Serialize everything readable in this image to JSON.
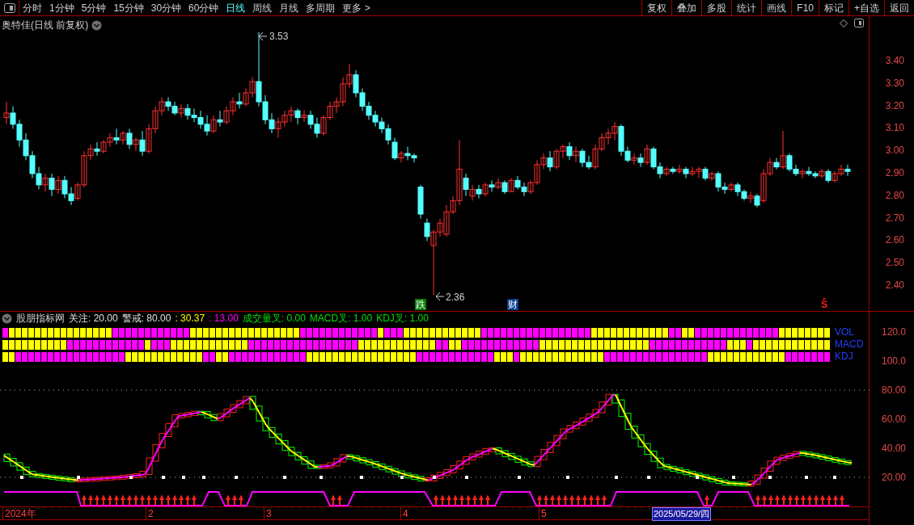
{
  "toolbar": {
    "periods": [
      {
        "label": "分时",
        "selected": false
      },
      {
        "label": "1分钟",
        "selected": false
      },
      {
        "label": "5分钟",
        "selected": false
      },
      {
        "label": "15分钟",
        "selected": false
      },
      {
        "label": "30分钟",
        "selected": false
      },
      {
        "label": "60分钟",
        "selected": false
      },
      {
        "label": "日线",
        "selected": true
      },
      {
        "label": "周线",
        "selected": false
      },
      {
        "label": "月线",
        "selected": false
      },
      {
        "label": "多周期",
        "selected": false
      },
      {
        "label": "更多 >",
        "selected": false
      }
    ],
    "buttons": [
      "复权",
      "叠加",
      "多股",
      "统计",
      "画线",
      "F10",
      "标记",
      "+自选",
      "返回"
    ]
  },
  "chart": {
    "title": "奥特佳(日线 前复权)",
    "high_marker": "3.53",
    "low_marker": "2.36",
    "events": [
      {
        "label": "跌",
        "color": "#008000"
      },
      {
        "label": "财",
        "color": "#0a3a8a"
      },
      {
        "label": "Ŝ",
        "color": "#000000"
      }
    ],
    "chart_data": {
      "type": "candlestick",
      "ohlc": [
        [
          3.15,
          3.22,
          3.12,
          3.17
        ],
        [
          3.17,
          3.2,
          3.1,
          3.12
        ],
        [
          3.12,
          3.14,
          3.02,
          3.05
        ],
        [
          3.05,
          3.08,
          2.96,
          2.98
        ],
        [
          2.98,
          3.0,
          2.88,
          2.9
        ],
        [
          2.9,
          2.93,
          2.83,
          2.85
        ],
        [
          2.85,
          2.9,
          2.82,
          2.88
        ],
        [
          2.88,
          2.9,
          2.8,
          2.83
        ],
        [
          2.83,
          2.89,
          2.81,
          2.87
        ],
        [
          2.87,
          2.89,
          2.79,
          2.81
        ],
        [
          2.81,
          2.84,
          2.76,
          2.78
        ],
        [
          2.79,
          2.86,
          2.78,
          2.85
        ],
        [
          2.85,
          3.0,
          2.84,
          2.98
        ],
        [
          2.98,
          3.03,
          2.96,
          3.01
        ],
        [
          3.01,
          3.04,
          2.98,
          3.0
        ],
        [
          3.0,
          3.05,
          2.99,
          3.04
        ],
        [
          3.04,
          3.08,
          3.02,
          3.06
        ],
        [
          3.06,
          3.1,
          3.03,
          3.05
        ],
        [
          3.05,
          3.09,
          3.03,
          3.08
        ],
        [
          3.08,
          3.1,
          3.01,
          3.03
        ],
        [
          3.03,
          3.06,
          3.0,
          3.05
        ],
        [
          3.05,
          3.09,
          2.98,
          3.0
        ],
        [
          3.0,
          3.12,
          2.99,
          3.1
        ],
        [
          3.1,
          3.2,
          3.08,
          3.18
        ],
        [
          3.18,
          3.24,
          3.16,
          3.22
        ],
        [
          3.22,
          3.24,
          3.18,
          3.2
        ],
        [
          3.2,
          3.22,
          3.16,
          3.17
        ],
        [
          3.17,
          3.21,
          3.15,
          3.19
        ],
        [
          3.19,
          3.21,
          3.14,
          3.16
        ],
        [
          3.16,
          3.19,
          3.13,
          3.15
        ],
        [
          3.15,
          3.18,
          3.1,
          3.12
        ],
        [
          3.12,
          3.16,
          3.07,
          3.09
        ],
        [
          3.09,
          3.16,
          3.08,
          3.14
        ],
        [
          3.14,
          3.18,
          3.11,
          3.13
        ],
        [
          3.13,
          3.2,
          3.12,
          3.18
        ],
        [
          3.18,
          3.24,
          3.16,
          3.22
        ],
        [
          3.22,
          3.26,
          3.19,
          3.21
        ],
        [
          3.21,
          3.28,
          3.2,
          3.26
        ],
        [
          3.26,
          3.33,
          3.24,
          3.31
        ],
        [
          3.31,
          3.53,
          3.2,
          3.22
        ],
        [
          3.22,
          3.25,
          3.12,
          3.14
        ],
        [
          3.14,
          3.17,
          3.08,
          3.1
        ],
        [
          3.1,
          3.15,
          3.06,
          3.13
        ],
        [
          3.13,
          3.18,
          3.11,
          3.16
        ],
        [
          3.16,
          3.2,
          3.13,
          3.18
        ],
        [
          3.18,
          3.19,
          3.12,
          3.15
        ],
        [
          3.15,
          3.18,
          3.13,
          3.16
        ],
        [
          3.16,
          3.18,
          3.1,
          3.12
        ],
        [
          3.12,
          3.15,
          3.06,
          3.08
        ],
        [
          3.08,
          3.16,
          3.07,
          3.15
        ],
        [
          3.15,
          3.22,
          3.14,
          3.2
        ],
        [
          3.2,
          3.24,
          3.17,
          3.22
        ],
        [
          3.22,
          3.33,
          3.2,
          3.3
        ],
        [
          3.3,
          3.39,
          3.28,
          3.34
        ],
        [
          3.34,
          3.36,
          3.24,
          3.26
        ],
        [
          3.26,
          3.28,
          3.18,
          3.2
        ],
        [
          3.2,
          3.22,
          3.14,
          3.16
        ],
        [
          3.16,
          3.18,
          3.11,
          3.13
        ],
        [
          3.13,
          3.15,
          3.08,
          3.1
        ],
        [
          3.1,
          3.12,
          3.03,
          3.05
        ],
        [
          3.04,
          3.06,
          2.96,
          2.97
        ],
        [
          2.97,
          3.0,
          2.95,
          2.99
        ],
        [
          2.99,
          3.02,
          2.96,
          2.98
        ],
        [
          2.98,
          2.99,
          2.95,
          2.97
        ],
        [
          2.84,
          2.85,
          2.7,
          2.72
        ],
        [
          2.68,
          2.7,
          2.6,
          2.62
        ],
        [
          2.58,
          2.65,
          2.36,
          2.64
        ],
        [
          2.64,
          2.7,
          2.62,
          2.68
        ],
        [
          2.63,
          2.76,
          2.62,
          2.73
        ],
        [
          2.73,
          2.8,
          2.72,
          2.78
        ],
        [
          2.78,
          3.05,
          2.76,
          2.92
        ],
        [
          2.88,
          2.9,
          2.8,
          2.83
        ],
        [
          2.8,
          2.85,
          2.78,
          2.83
        ],
        [
          2.83,
          2.85,
          2.79,
          2.81
        ],
        [
          2.81,
          2.86,
          2.8,
          2.85
        ],
        [
          2.85,
          2.87,
          2.82,
          2.84
        ],
        [
          2.84,
          2.88,
          2.83,
          2.86
        ],
        [
          2.86,
          2.87,
          2.81,
          2.82
        ],
        [
          2.82,
          2.88,
          2.82,
          2.87
        ],
        [
          2.87,
          2.89,
          2.83,
          2.84
        ],
        [
          2.84,
          2.86,
          2.8,
          2.82
        ],
        [
          2.82,
          2.87,
          2.81,
          2.86
        ],
        [
          2.86,
          2.96,
          2.85,
          2.94
        ],
        [
          2.94,
          2.99,
          2.92,
          2.97
        ],
        [
          2.97,
          3.0,
          2.91,
          2.93
        ],
        [
          2.93,
          3.01,
          2.92,
          3.0
        ],
        [
          3.0,
          3.03,
          2.97,
          3.02
        ],
        [
          3.02,
          3.04,
          2.96,
          2.98
        ],
        [
          2.98,
          3.02,
          2.95,
          3.0
        ],
        [
          3.0,
          3.01,
          2.93,
          2.95
        ],
        [
          2.95,
          2.98,
          2.92,
          2.93
        ],
        [
          2.93,
          3.03,
          2.92,
          3.01
        ],
        [
          3.01,
          3.08,
          3.0,
          3.06
        ],
        [
          3.06,
          3.1,
          3.03,
          3.08
        ],
        [
          3.08,
          3.13,
          3.05,
          3.11
        ],
        [
          3.11,
          3.12,
          2.98,
          3.0
        ],
        [
          3.0,
          3.02,
          2.95,
          2.96
        ],
        [
          2.96,
          2.99,
          2.94,
          2.97
        ],
        [
          2.97,
          2.99,
          2.93,
          2.95
        ],
        [
          2.95,
          3.03,
          2.94,
          3.01
        ],
        [
          3.01,
          3.02,
          2.92,
          2.93
        ],
        [
          2.93,
          2.95,
          2.88,
          2.9
        ],
        [
          2.9,
          2.93,
          2.89,
          2.92
        ],
        [
          2.92,
          2.93,
          2.9,
          2.91
        ],
        [
          2.91,
          2.94,
          2.9,
          2.92
        ],
        [
          2.92,
          2.93,
          2.88,
          2.9
        ],
        [
          2.9,
          2.93,
          2.89,
          2.91
        ],
        [
          2.91,
          2.93,
          2.88,
          2.92
        ],
        [
          2.92,
          2.93,
          2.87,
          2.88
        ],
        [
          2.88,
          2.91,
          2.87,
          2.9
        ],
        [
          2.9,
          2.91,
          2.82,
          2.84
        ],
        [
          2.84,
          2.86,
          2.81,
          2.83
        ],
        [
          2.83,
          2.86,
          2.82,
          2.85
        ],
        [
          2.85,
          2.86,
          2.8,
          2.82
        ],
        [
          2.82,
          2.83,
          2.78,
          2.79
        ],
        [
          2.79,
          2.82,
          2.77,
          2.8
        ],
        [
          2.8,
          2.81,
          2.75,
          2.76
        ],
        [
          2.78,
          2.92,
          2.77,
          2.9
        ],
        [
          2.9,
          2.97,
          2.89,
          2.95
        ],
        [
          2.95,
          2.97,
          2.92,
          2.93
        ],
        [
          2.93,
          3.09,
          2.92,
          2.98
        ],
        [
          2.98,
          2.99,
          2.91,
          2.92
        ],
        [
          2.92,
          2.94,
          2.89,
          2.9
        ],
        [
          2.9,
          2.92,
          2.88,
          2.91
        ],
        [
          2.91,
          2.93,
          2.89,
          2.9
        ],
        [
          2.9,
          2.91,
          2.88,
          2.89
        ],
        [
          2.89,
          2.92,
          2.88,
          2.91
        ],
        [
          2.91,
          2.92,
          2.86,
          2.87
        ],
        [
          2.87,
          2.91,
          2.86,
          2.9
        ],
        [
          2.9,
          2.94,
          2.89,
          2.92
        ],
        [
          2.92,
          2.94,
          2.89,
          2.91
        ]
      ]
    },
    "price_axis": [
      "3.40",
      "3.30",
      "3.20",
      "3.10",
      "3.00",
      "2.90",
      "2.80",
      "2.70",
      "2.60",
      "2.50",
      "2.40"
    ]
  },
  "indicator": {
    "name": "股朋指标网",
    "legend": [
      {
        "label": "关注: 20.00",
        "color": "#e0e0e0"
      },
      {
        "label": "警戒: 80.00",
        "color": "#e0e0e0"
      },
      {
        "label": ": 30.37",
        "color": "#ffff00"
      },
      {
        "label": ": 13.00",
        "color": "#ff00ff"
      },
      {
        "label": "成交量叉: 0.00",
        "color": "#00e000"
      },
      {
        "label": "MACD叉: 1.00",
        "color": "#00e000"
      },
      {
        "label": "KDJ叉: 1.00",
        "color": "#00e000"
      }
    ],
    "signal_rows": [
      {
        "label": "VOL"
      },
      {
        "label": "MACD"
      },
      {
        "label": "KDJ"
      }
    ],
    "axis": [
      "120.0",
      "100.0",
      "80.00",
      "60.00",
      "40.00",
      "20.00"
    ]
  },
  "date_axis": [
    {
      "label": "2024年",
      "kind": "month"
    },
    {
      "label": "2",
      "kind": "month"
    },
    {
      "label": "3",
      "kind": "month"
    },
    {
      "label": "4",
      "kind": "month"
    },
    {
      "label": "5",
      "kind": "month"
    },
    {
      "label": "2025/05/29/四",
      "kind": "cursor"
    }
  ]
}
